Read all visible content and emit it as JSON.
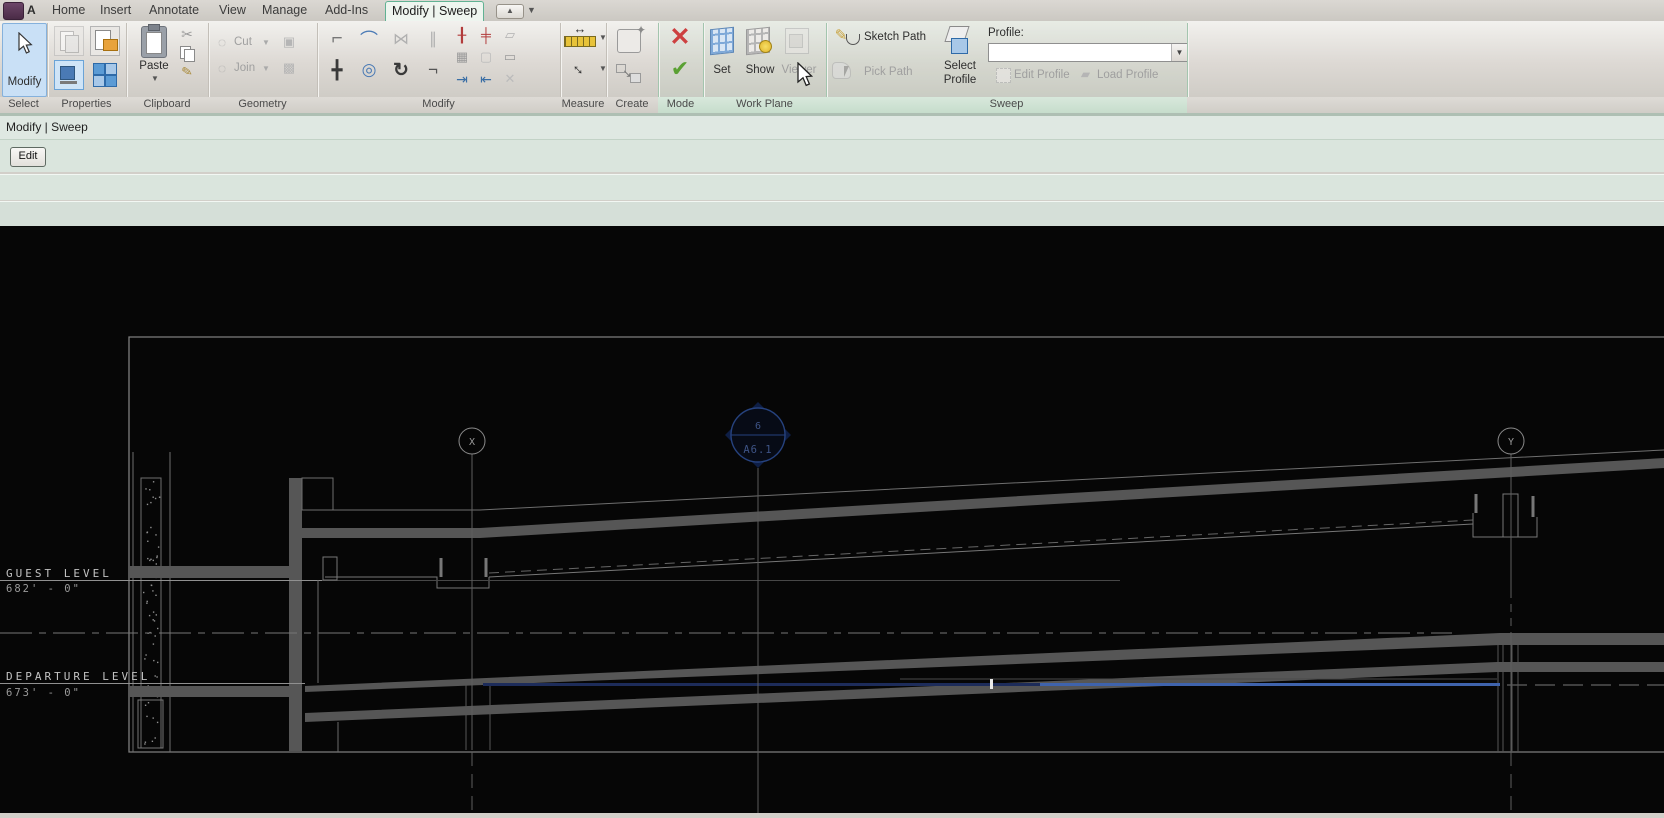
{
  "window": {
    "app_button": "A"
  },
  "tabs": {
    "items": [
      {
        "label": "Home"
      },
      {
        "label": "Insert"
      },
      {
        "label": "Annotate"
      },
      {
        "label": "View"
      },
      {
        "label": "Manage"
      },
      {
        "label": "Add-Ins"
      },
      {
        "label": "Modify | Sweep"
      }
    ]
  },
  "ribbon": {
    "select": {
      "label": "Select",
      "modify": "Modify"
    },
    "properties": {
      "label": "Properties"
    },
    "clipboard": {
      "label": "Clipboard",
      "paste": "Paste"
    },
    "geometry": {
      "label": "Geometry",
      "cut": "Cut",
      "join": "Join"
    },
    "modify_panel": {
      "label": "Modify"
    },
    "measure": {
      "label": "Measure"
    },
    "create": {
      "label": "Create"
    },
    "mode": {
      "label": "Mode"
    },
    "workplane": {
      "label": "Work Plane",
      "set": "Set",
      "show": "Show",
      "viewer": "Viewer"
    },
    "sweep": {
      "label": "Sweep",
      "sketch_path": "Sketch Path",
      "pick_path": "Pick Path",
      "select_profile_line1": "Select",
      "select_profile_line2": "Profile",
      "profile_label": "Profile:",
      "profile_value": "",
      "edit_profile": "Edit Profile",
      "load_profile": "Load Profile"
    }
  },
  "options_bar": {
    "context": "Modify | Sweep",
    "edit": "Edit"
  },
  "canvas": {
    "levels": [
      {
        "name": "GUEST LEVEL",
        "elevation": "682' - 0\""
      },
      {
        "name": "DEPARTURE LEVEL",
        "elevation": "673' - 0\""
      }
    ],
    "grid_bubbles": [
      {
        "label": "X"
      },
      {
        "label": "Y"
      }
    ],
    "section_marker": {
      "top": "6",
      "bottom": "A6.1"
    },
    "colors": {
      "path_blue": "#3f63ac",
      "path_blue_dark": "#1d2c5a",
      "marker_navy": "#0e1e45",
      "slab_gray": "#565656",
      "line_gray": "#7d7d7d"
    }
  }
}
